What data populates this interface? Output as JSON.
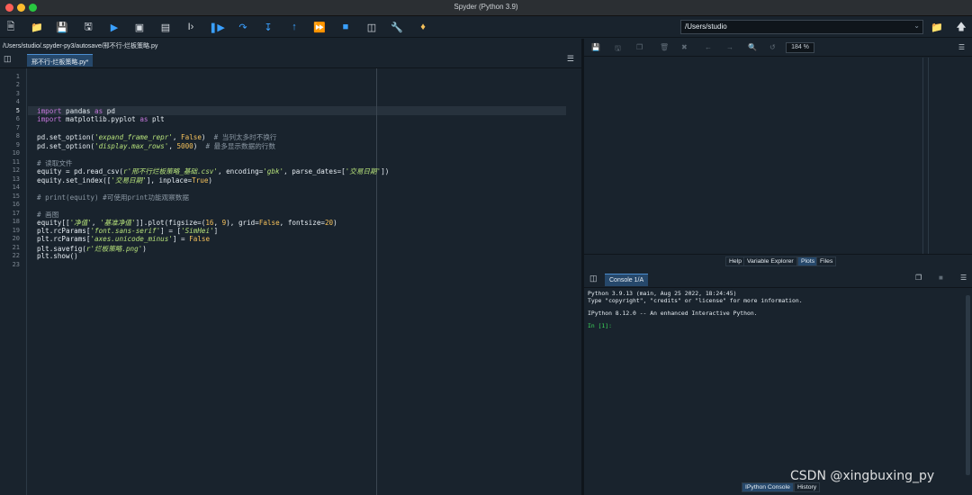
{
  "window": {
    "title": "Spyder (Python 3.9)",
    "traffic_lights": [
      "#ff5f57",
      "#febc2e",
      "#28c840"
    ]
  },
  "toolbar": {
    "icons": [
      "new-file-icon",
      "open-folder-icon",
      "save-icon",
      "save-all-icon",
      "run-icon",
      "run-cell-icon",
      "run-cell-advance-icon",
      "run-selection-icon",
      "debug-icon",
      "step-icon",
      "step-into-icon",
      "step-return-icon",
      "continue-icon",
      "stop-icon",
      "maximize-pane-icon",
      "preferences-wrench-icon",
      "python-path-icon"
    ],
    "working_dir": "/Users/studio",
    "browse_icon": "folder-icon",
    "parent_icon": "up-arrow-icon"
  },
  "editor": {
    "path": "/Users/studio/.spyder-py3/autosave/邢不行-烂板策略.py",
    "tab_label": "邢不行-烂板策略.py*",
    "active_line": 5,
    "line_numbers": [
      "1",
      "2",
      "3",
      "4",
      "5",
      "6",
      "7",
      "8",
      "9",
      "10",
      "11",
      "12",
      "13",
      "14",
      "15",
      "16",
      "17",
      "18",
      "19",
      "20",
      "21",
      "22",
      "23"
    ]
  },
  "code": {
    "l5_kw1": "import",
    "l5_mod": " pandas ",
    "l5_kw2": "as",
    "l5_alias": " pd",
    "l6_kw1": "import",
    "l6_mod": " matplotlib.pyplot ",
    "l6_kw2": "as",
    "l6_alias": " plt",
    "l8_a": "pd.set_option(",
    "l8_str": "'expand_frame_repr'",
    "l8_b": ", ",
    "l8_bool": "False",
    "l8_c": ")  ",
    "l8_cm": "# 当列太多时不换行",
    "l9_a": "pd.set_option(",
    "l9_str": "'display.max_rows'",
    "l9_b": ", ",
    "l9_num": "5000",
    "l9_c": ")  ",
    "l9_cm": "# 最多显示数据的行数",
    "l11_cm": "# 读取文件",
    "l12_a": "equity = pd.read_csv(",
    "l12_str": "r'邢不行烂板策略_基础.csv'",
    "l12_b": ", encoding=",
    "l12_str2": "'gbk'",
    "l12_c": ", parse_dates=[",
    "l12_str3": "'交易日期'",
    "l12_d": "])",
    "l13_a": "equity.set_index([",
    "l13_str": "'交易日期'",
    "l13_b": "], inplace=",
    "l13_bool": "True",
    "l13_c": ")",
    "l15_cm": "# print(equity) #可使用print功能观察数据",
    "l17_cm": "# 画图",
    "l18_a": "equity[[",
    "l18_str1": "'净值'",
    "l18_b": ", ",
    "l18_str2": "'基准净值'",
    "l18_c": "]].plot(figsize=(",
    "l18_num1": "16",
    "l18_d": ", ",
    "l18_num2": "9",
    "l18_e": "), grid=",
    "l18_bool": "False",
    "l18_f": ", fontsize=",
    "l18_num3": "20",
    "l18_g": ")",
    "l19_a": "plt.rcParams[",
    "l19_str1": "'font.sans-serif'",
    "l19_b": "] = [",
    "l19_str2": "'SimHei'",
    "l19_c": "]",
    "l20_a": "plt.rcParams[",
    "l20_str": "'axes.unicode_minus'",
    "l20_b": "] = ",
    "l20_bool": "False",
    "l21_a": "plt.savefig(",
    "l21_str": "r'烂板策略.png'",
    "l21_b": ")",
    "l22": "plt.show()"
  },
  "plots": {
    "zoom": "184 %",
    "tabs": [
      "Help",
      "Variable Explorer",
      "Plots",
      "Files"
    ],
    "active_tab": "Plots"
  },
  "console": {
    "tab_label": "Console 1/A",
    "line1": "Python 3.9.13 (main, Aug 25 2022, 18:24:45)",
    "line2": "Type \"copyright\", \"credits\" or \"license\" for more information.",
    "line3": "IPython 8.12.0 -- An enhanced Interactive Python.",
    "prompt": "In [1]:",
    "tabs": [
      "IPython Console",
      "History"
    ],
    "active_tab": "IPython Console"
  },
  "watermark": "CSDN @xingbuxing_py"
}
